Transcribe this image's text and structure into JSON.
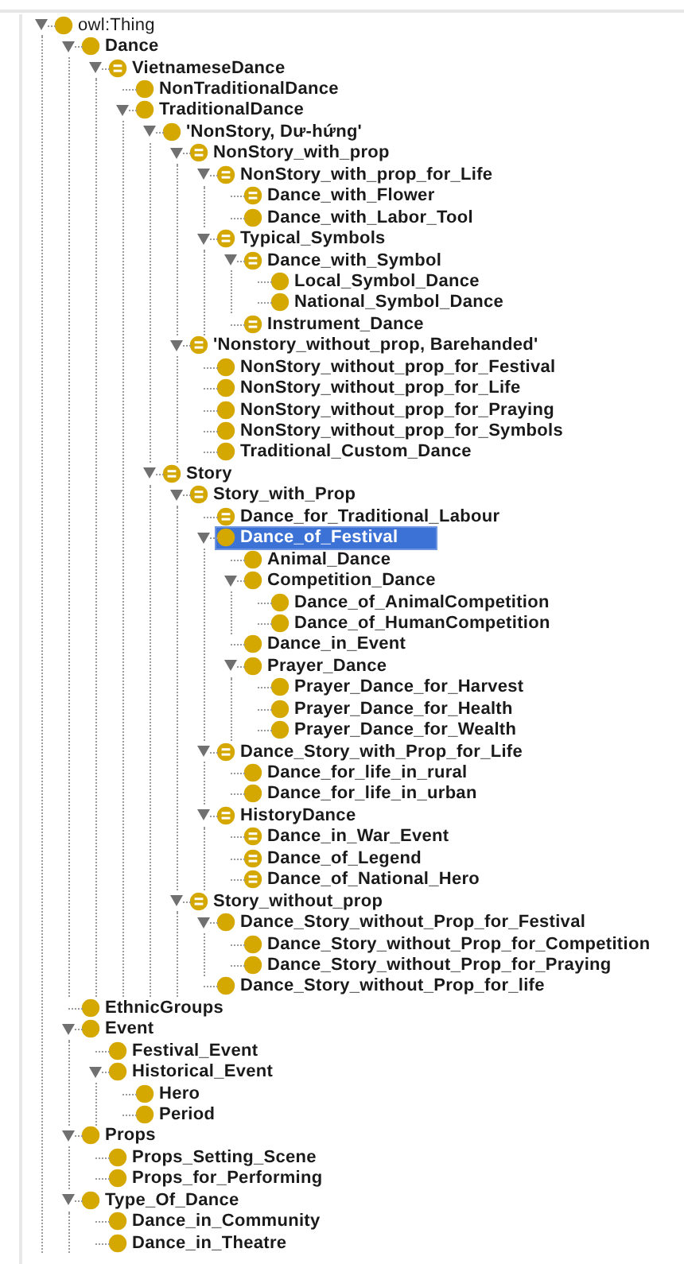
{
  "tree": [
    {
      "label": "owl:Thing",
      "kind": "root",
      "selected": false,
      "expanded": true,
      "children": [
        {
          "label": "Dance",
          "kind": "primitive",
          "selected": false,
          "expanded": true,
          "children": [
            {
              "label": "VietnameseDance",
              "kind": "defined",
              "selected": false,
              "expanded": true,
              "children": [
                {
                  "label": "NonTraditionalDance",
                  "kind": "primitive",
                  "selected": false
                },
                {
                  "label": "TraditionalDance",
                  "kind": "primitive",
                  "selected": false,
                  "expanded": true,
                  "children": [
                    {
                      "label": "'NonStory, Dư-hứng'",
                      "kind": "primitive",
                      "selected": false,
                      "expanded": true,
                      "children": [
                        {
                          "label": "NonStory_with_prop",
                          "kind": "defined",
                          "selected": false,
                          "expanded": true,
                          "children": [
                            {
                              "label": "NonStory_with_prop_for_Life",
                              "kind": "defined",
                              "selected": false,
                              "expanded": true,
                              "children": [
                                {
                                  "label": "Dance_with_Flower",
                                  "kind": "defined",
                                  "selected": false
                                },
                                {
                                  "label": "Dance_with_Labor_Tool",
                                  "kind": "primitive",
                                  "selected": false
                                }
                              ]
                            },
                            {
                              "label": "Typical_Symbols",
                              "kind": "defined",
                              "selected": false,
                              "expanded": true,
                              "children": [
                                {
                                  "label": "Dance_with_Symbol",
                                  "kind": "defined",
                                  "selected": false,
                                  "expanded": true,
                                  "children": [
                                    {
                                      "label": "Local_Symbol_Dance",
                                      "kind": "primitive",
                                      "selected": false
                                    },
                                    {
                                      "label": "National_Symbol_Dance",
                                      "kind": "primitive",
                                      "selected": false
                                    }
                                  ]
                                },
                                {
                                  "label": "Instrument_Dance",
                                  "kind": "defined",
                                  "selected": false
                                }
                              ]
                            }
                          ]
                        },
                        {
                          "label": "'Nonstory_without_prop, Barehanded'",
                          "kind": "defined",
                          "selected": false,
                          "expanded": true,
                          "children": [
                            {
                              "label": "NonStory_without_prop_for_Festival",
                              "kind": "primitive",
                              "selected": false
                            },
                            {
                              "label": "NonStory_without_prop_for_Life",
                              "kind": "primitive",
                              "selected": false
                            },
                            {
                              "label": "NonStory_without_prop_for_Praying",
                              "kind": "primitive",
                              "selected": false
                            },
                            {
                              "label": "NonStory_without_prop_for_Symbols",
                              "kind": "primitive",
                              "selected": false
                            },
                            {
                              "label": "Traditional_Custom_Dance",
                              "kind": "primitive",
                              "selected": false
                            }
                          ]
                        }
                      ]
                    },
                    {
                      "label": "Story",
                      "kind": "defined",
                      "selected": false,
                      "expanded": true,
                      "children": [
                        {
                          "label": "Story_with_Prop",
                          "kind": "defined",
                          "selected": false,
                          "expanded": true,
                          "children": [
                            {
                              "label": "Dance_for_Traditional_Labour",
                              "kind": "defined",
                              "selected": false
                            },
                            {
                              "label": "Dance_of_Festival",
                              "kind": "primitive",
                              "selected": true,
                              "expanded": true,
                              "children": [
                                {
                                  "label": "Animal_Dance",
                                  "kind": "primitive",
                                  "selected": false
                                },
                                {
                                  "label": "Competition_Dance",
                                  "kind": "primitive",
                                  "selected": false,
                                  "expanded": true,
                                  "children": [
                                    {
                                      "label": "Dance_of_AnimalCompetition",
                                      "kind": "primitive",
                                      "selected": false
                                    },
                                    {
                                      "label": "Dance_of_HumanCompetition",
                                      "kind": "primitive",
                                      "selected": false
                                    }
                                  ]
                                },
                                {
                                  "label": "Dance_in_Event",
                                  "kind": "primitive",
                                  "selected": false
                                },
                                {
                                  "label": "Prayer_Dance",
                                  "kind": "primitive",
                                  "selected": false,
                                  "expanded": true,
                                  "children": [
                                    {
                                      "label": "Prayer_Dance_for_Harvest",
                                      "kind": "primitive",
                                      "selected": false
                                    },
                                    {
                                      "label": "Prayer_Dance_for_Health",
                                      "kind": "primitive",
                                      "selected": false
                                    },
                                    {
                                      "label": "Prayer_Dance_for_Wealth",
                                      "kind": "primitive",
                                      "selected": false
                                    }
                                  ]
                                }
                              ]
                            },
                            {
                              "label": "Dance_Story_with_Prop_for_Life",
                              "kind": "defined",
                              "selected": false,
                              "expanded": true,
                              "children": [
                                {
                                  "label": "Dance_for_life_in_rural",
                                  "kind": "primitive",
                                  "selected": false
                                },
                                {
                                  "label": "Dance_for_life_in_urban",
                                  "kind": "primitive",
                                  "selected": false
                                }
                              ]
                            },
                            {
                              "label": "HistoryDance",
                              "kind": "defined",
                              "selected": false,
                              "expanded": true,
                              "children": [
                                {
                                  "label": "Dance_in_War_Event",
                                  "kind": "defined",
                                  "selected": false
                                },
                                {
                                  "label": "Dance_of_Legend",
                                  "kind": "defined",
                                  "selected": false
                                },
                                {
                                  "label": "Dance_of_National_Hero",
                                  "kind": "defined",
                                  "selected": false
                                }
                              ]
                            }
                          ]
                        },
                        {
                          "label": "Story_without_prop",
                          "kind": "defined",
                          "selected": false,
                          "expanded": true,
                          "children": [
                            {
                              "label": "Dance_Story_without_Prop_for_Festival",
                              "kind": "primitive",
                              "selected": false,
                              "expanded": true,
                              "children": [
                                {
                                  "label": "Dance_Story_without_Prop_for_Competition",
                                  "kind": "primitive",
                                  "selected": false
                                },
                                {
                                  "label": "Dance_Story_without_Prop_for_Praying",
                                  "kind": "primitive",
                                  "selected": false
                                }
                              ]
                            },
                            {
                              "label": "Dance_Story_without_Prop_for_life",
                              "kind": "primitive",
                              "selected": false
                            }
                          ]
                        }
                      ]
                    }
                  ]
                }
              ]
            }
          ]
        },
        {
          "label": "EthnicGroups",
          "kind": "primitive",
          "selected": false
        },
        {
          "label": "Event",
          "kind": "primitive",
          "selected": false,
          "expanded": true,
          "children": [
            {
              "label": "Festival_Event",
              "kind": "primitive",
              "selected": false
            },
            {
              "label": "Historical_Event",
              "kind": "primitive",
              "selected": false,
              "expanded": true,
              "children": [
                {
                  "label": "Hero",
                  "kind": "primitive",
                  "selected": false
                },
                {
                  "label": "Period",
                  "kind": "primitive",
                  "selected": false
                }
              ]
            }
          ]
        },
        {
          "label": "Props",
          "kind": "primitive",
          "selected": false,
          "expanded": true,
          "children": [
            {
              "label": "Props_Setting_Scene",
              "kind": "primitive",
              "selected": false
            },
            {
              "label": "Props_for_Performing",
              "kind": "primitive",
              "selected": false
            }
          ]
        },
        {
          "label": "Type_Of_Dance",
          "kind": "primitive",
          "selected": false,
          "expanded": true,
          "children": [
            {
              "label": "Dance_in_Community",
              "kind": "primitive",
              "selected": false
            },
            {
              "label": "Dance_in_Theatre",
              "kind": "primitive",
              "selected": false
            }
          ]
        }
      ]
    }
  ]
}
